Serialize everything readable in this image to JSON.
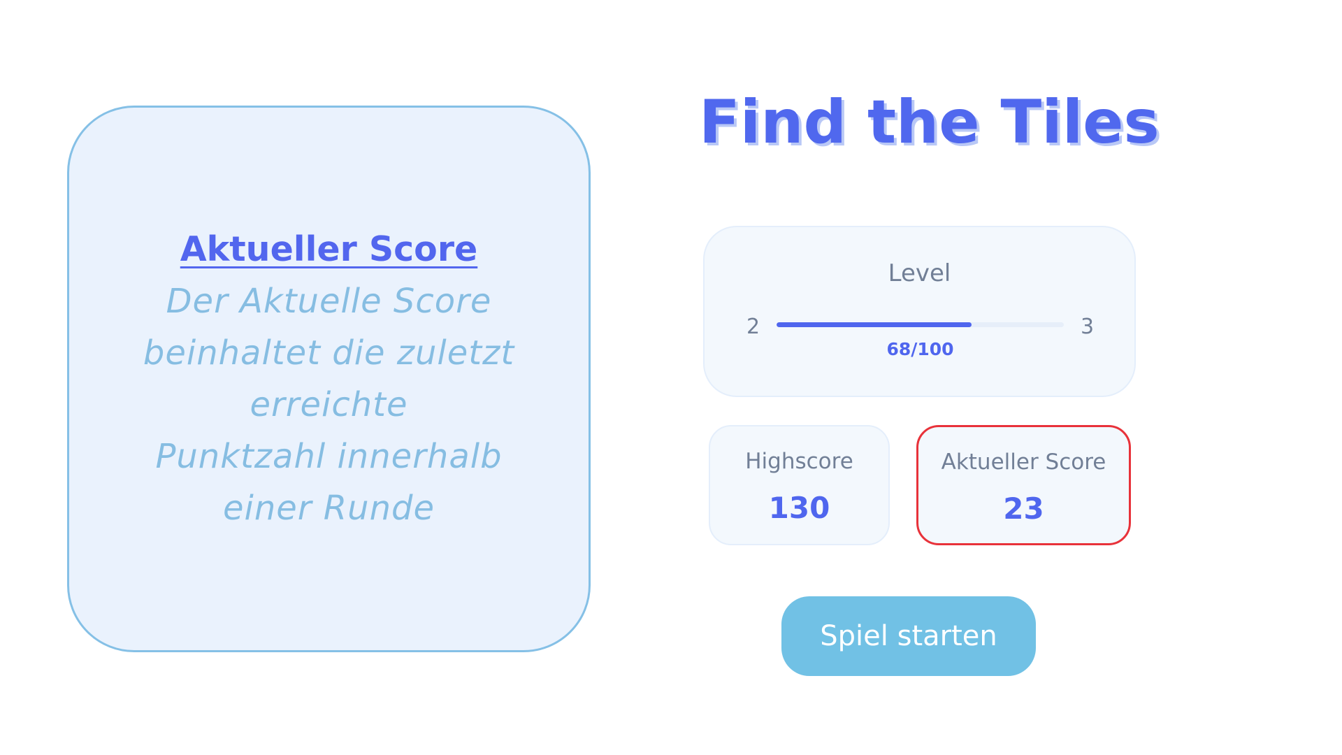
{
  "info_card": {
    "title": "Aktueller Score",
    "lines": [
      "Der Aktuelle Score",
      "beinhaltet die zuletzt",
      "erreichte",
      "Punktzahl innerhalb",
      "einer Runde"
    ]
  },
  "app": {
    "title": "Find the Tiles"
  },
  "level": {
    "label": "Level",
    "current_level": "2",
    "next_level": "3",
    "progress_text": "68/100",
    "progress_value": 68,
    "progress_max": 100
  },
  "stats": {
    "highscore": {
      "label": "Highscore",
      "value": "130"
    },
    "current_score": {
      "label": "Aktueller Score",
      "value": "23"
    }
  },
  "actions": {
    "start_label": "Spiel starten"
  },
  "colors": {
    "accent": "#4f66ee",
    "highlight_border": "#e8323a",
    "button": "#71c1e5",
    "info_border": "#85c0e6"
  }
}
